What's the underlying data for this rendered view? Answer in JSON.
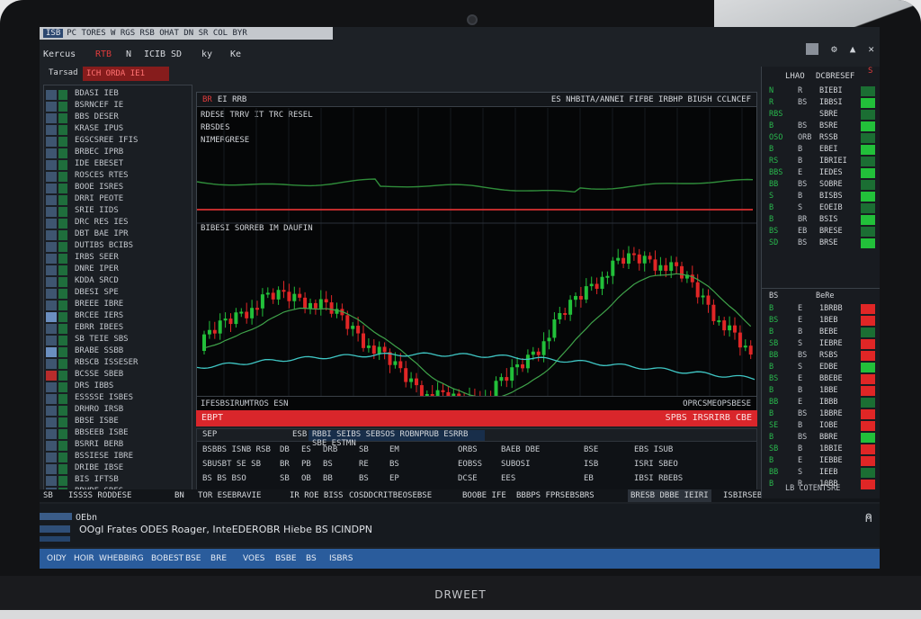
{
  "window": {
    "title_code": "ISB",
    "title": "PC TORES W RGS RSB OHAT DN SR COL BYR"
  },
  "menu": {
    "items": [
      "Kercus",
      "RTB",
      "N",
      "ICIB",
      "SD",
      "ky",
      "Ke"
    ]
  },
  "subbar": {
    "label": "Tarsad",
    "tag": "ICH ORDA IE1"
  },
  "left_panel": {
    "items": [
      "BDASI IEB",
      "BSRNCEF IE",
      "BBS DESER",
      "KRASE IPUS",
      "EGSCSREE IFIS",
      "BRBEC IPRB",
      "IDE EBESET",
      "ROSCES RTES",
      "BOOE ISRES",
      "DRRI PEOTE",
      "SRIE IIDS",
      "DRC RES IES",
      "DBT BAE IPR",
      "DUTIBS BCIBS",
      "IRBS SEER",
      "DNRE IPER",
      "KDDA SRCD",
      "DBESI SPE",
      "BREEE IBRE",
      "BRCEE IERS",
      "EBRR IBEES",
      "SB TEIE SBS",
      "BRABE SSBB",
      "RBSCB ISSESER",
      "BCSSE SBEB",
      "DRS IBBS",
      "ESSSSE ISBES",
      "DRHRO IRSB",
      "BBSE ISBE",
      "BBSEEB ISBE",
      "BSRRI BERB",
      "BSSIESE IBRE",
      "DRIBE IBSE",
      "BIS IFTSB",
      "BRHRE SBES"
    ]
  },
  "chart": {
    "header_code": "BR",
    "header_left": "EI RRB",
    "header_right": "ES NHBITA/ANNEI FIFBE IRBHP BIUSH CCLNCEF",
    "info": [
      "RDESE   TRRV IT TRC RESEL",
      "RBSDES",
      "NIMERGRESE"
    ],
    "sep_label": "BIBESI SORREB IM DAUFIN",
    "bottom_left": "IFESBSIRUMTROS ESN",
    "bottom_right": "OPRCSMEOPSBESE"
  },
  "alert": {
    "left": "EBPT",
    "right": "SPBS IRSRIRB CBE"
  },
  "table": {
    "head": [
      "SEP",
      "ESB",
      "RBBI SEIBS SEBSOS ROBNPRUB ESRRB SBE ESTMN"
    ],
    "rows": [
      [
        "BSBBS ISNB  RSB",
        "DB",
        "ES",
        "DRB",
        "SB",
        "EM",
        "ORBS",
        "BAEB DBE",
        "BSE",
        "EBS ISUB"
      ],
      [
        "SBUSBT  SE  SB",
        "BR",
        "PB",
        "BS",
        "RE",
        "BS",
        "EOBSS",
        "SUBOSI",
        "ISB",
        "ISRI SBEO"
      ],
      [
        "BS  BS  BSO",
        "SB",
        "OB",
        "BB",
        "BS",
        "EP",
        "DCSE",
        "EES",
        "EB",
        "IBSI RBEBS"
      ]
    ]
  },
  "status_strip": {
    "items": [
      "SB",
      "ISSSS RODDESE",
      "BN",
      "TOR ESEBRAVIE",
      "IR ROE BISS",
      "COSDDCRITBEOSEBSE",
      "BOOBE IFE",
      "BBBPS FPRSEBSBRS",
      "BRESB DBBE IEIRI",
      "ISBIRSEB"
    ]
  },
  "right_panel": {
    "header": [
      "LHAO",
      "DCBRESEF",
      "S"
    ],
    "rows": [
      [
        "N",
        "R",
        "BIEBI"
      ],
      [
        "R",
        "BS",
        "IBBSI"
      ],
      [
        "RBS",
        "",
        "SBRE"
      ],
      [
        "B",
        "BS",
        "BSRE"
      ],
      [
        "OSO",
        "ORB",
        "RSSB"
      ],
      [
        "B",
        "B",
        "EBEI"
      ],
      [
        "RS",
        "B",
        "IBRIEI"
      ],
      [
        "BBS",
        "E",
        "IEDES"
      ],
      [
        "BB",
        "BS",
        "SOBRE"
      ],
      [
        "S",
        "B",
        "BISBS"
      ],
      [
        "B",
        "S",
        "EOEIB"
      ],
      [
        "B",
        "BR",
        "BSIS"
      ],
      [
        "BS",
        "EB",
        "BRESE"
      ],
      [
        "SD",
        "BS",
        "BRSE"
      ]
    ],
    "sep_label": [
      "BS",
      "BeRe"
    ],
    "rows2": [
      [
        "B",
        "E",
        "1BRBB"
      ],
      [
        "BS",
        "E",
        "1BEB"
      ],
      [
        "B",
        "B",
        "BEBE"
      ],
      [
        "SB",
        "S",
        "IEBRE"
      ],
      [
        "BB",
        "BS",
        "RSBS"
      ],
      [
        "B",
        "S",
        "EDBE"
      ],
      [
        "BS",
        "E",
        "BBEBE"
      ],
      [
        "B",
        "B",
        "1BBE"
      ],
      [
        "BB",
        "E",
        "IBBB"
      ],
      [
        "B",
        "BS",
        "1BBRE"
      ],
      [
        "SE",
        "B",
        "IOBE"
      ],
      [
        "B",
        "BS",
        "BBRE"
      ],
      [
        "SB",
        "B",
        "1BBIE"
      ],
      [
        "B",
        "E",
        "IEBBE"
      ],
      [
        "BB",
        "S",
        "IEEB"
      ],
      [
        "B",
        "R",
        "10BB"
      ]
    ],
    "footer": "LB  COTENTSRE"
  },
  "bottom_area": {
    "label": "OEbn",
    "text": "OOgl Frates  ODES Roager,  InteEDEROBR Hiebe  BS ICINDPN",
    "corner_icon": "person-icon"
  },
  "taskbar": {
    "items": [
      "OIDY",
      "HOIR",
      "WHEBBIRG",
      "BOBEST",
      "BSE",
      "BRE",
      "VOES",
      "BSBE",
      "BS",
      "ISBRS"
    ]
  },
  "brand": "DRWEET",
  "colors": {
    "bull": "#22c03a",
    "bear": "#e02626",
    "alert": "#d9262b",
    "taskbar": "#2a5c9c"
  }
}
